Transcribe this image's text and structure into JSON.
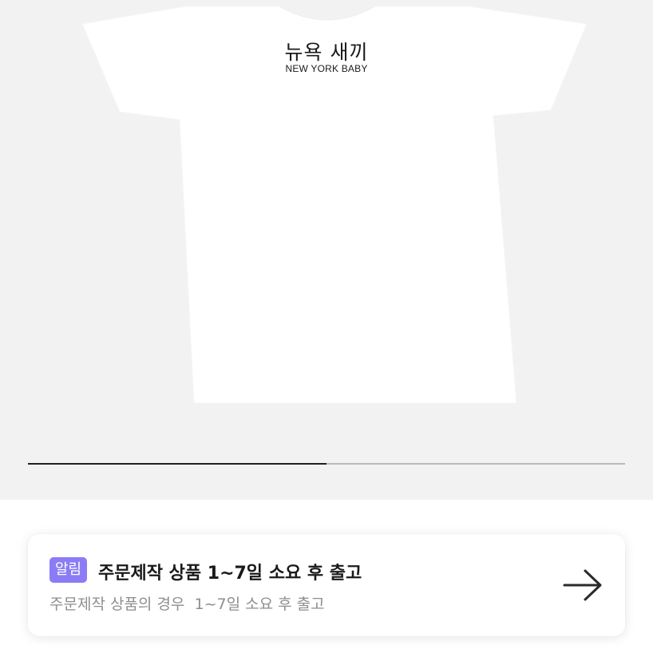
{
  "product_gallery": {
    "tee_print_korean": "뉴욕 새끼",
    "tee_print_english": "NEW YORK BABY",
    "progress_fraction": 0.5
  },
  "notice": {
    "badge": "알림",
    "title": "주문제작 상품 1~7일 소요 후 출고",
    "subtitle": "주문제작 상품의 경우  1~7일 소요 후 출고",
    "arrow_icon": "arrow-right-icon"
  },
  "colors": {
    "badge_bg": "#8b7cf6",
    "gallery_bg": "#f2f2f2",
    "progress_fill": "#1f1f1f",
    "progress_track": "#b9b9b9"
  }
}
